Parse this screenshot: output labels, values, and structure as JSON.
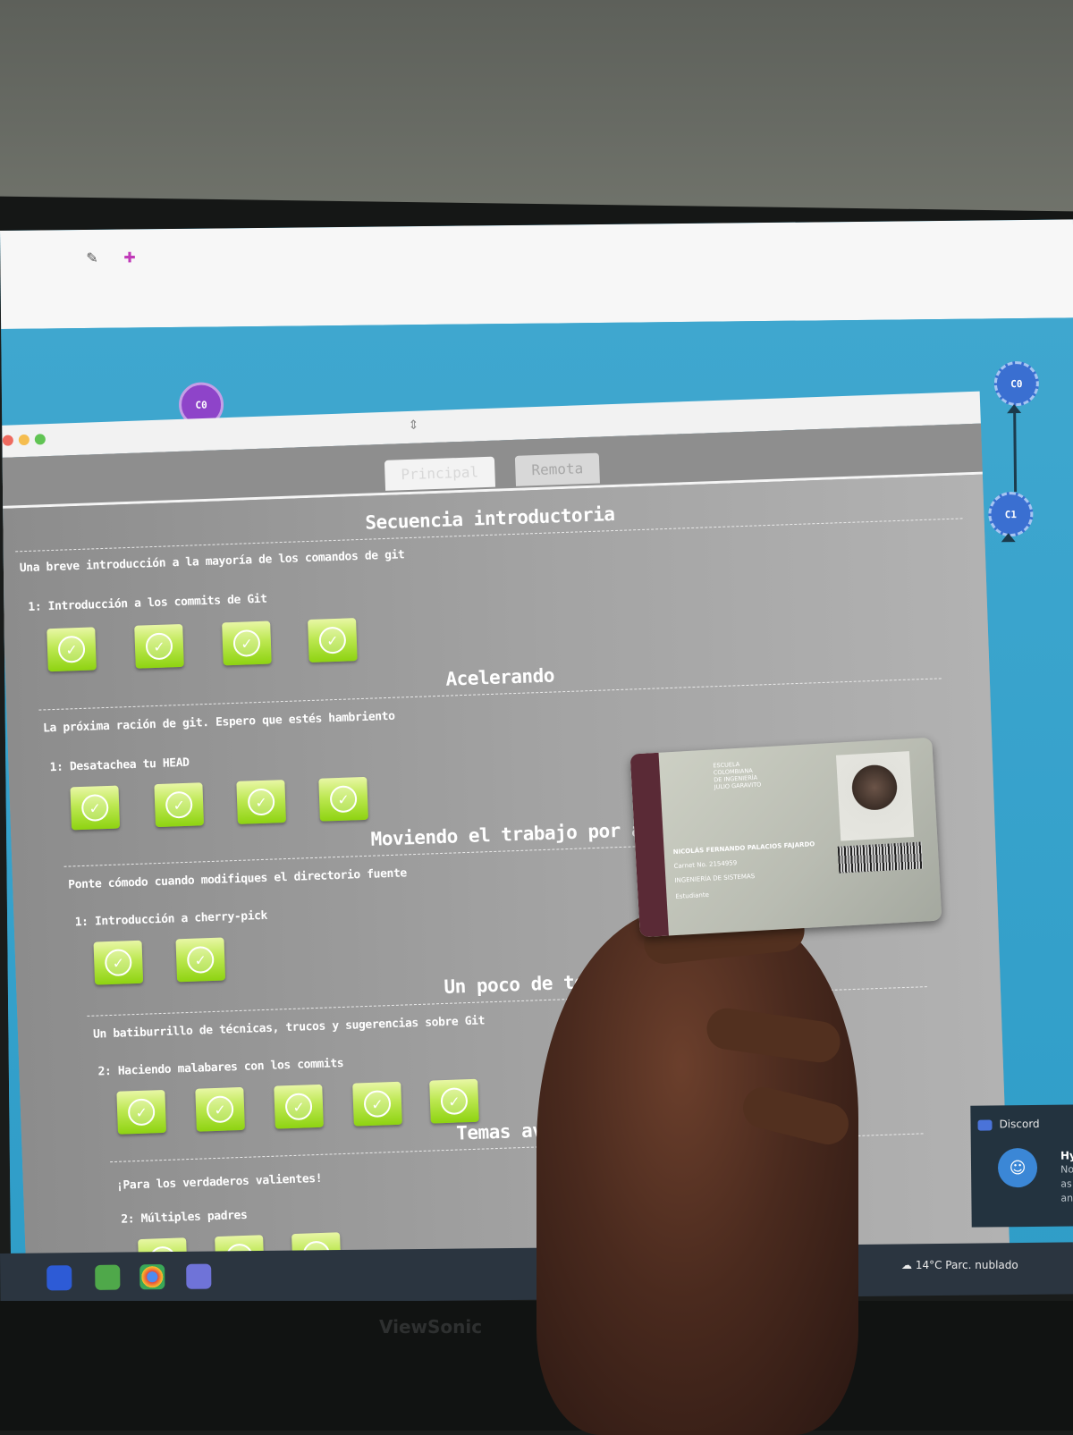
{
  "viz": {
    "node_left": "C0",
    "node_right_top": "C0",
    "node_right_mid": "C1"
  },
  "modal": {
    "tabs": [
      {
        "label": "Principal"
      },
      {
        "label": "Remota"
      }
    ],
    "sections": [
      {
        "title": "Secuencia introductoria",
        "about": "Una breve introducción a la mayoría de los comandos de git",
        "level_label": "1: Introducción a los commits de Git",
        "completed_levels": 4
      },
      {
        "title": "Acelerando",
        "about": "La próxima ración de git. Espero que estés hambriento",
        "level_label": "1: Desatachea tu HEAD",
        "completed_levels": 4
      },
      {
        "title": "Moviendo el trabajo por ahí",
        "about": "Ponte cómodo cuando modifiques el directorio fuente",
        "level_label": "1: Introducción a cherry-pick",
        "completed_levels": 2
      },
      {
        "title": "Un poco de todo",
        "about": "Un batiburrillo de técnicas, trucos y sugerencias sobre Git",
        "level_label": "2: Haciendo malabares con los commits",
        "completed_levels": 5
      },
      {
        "title": "Temas avanzados",
        "about": "¡Para los verdaderos valientes!",
        "level_label": "2: Múltiples padres",
        "completed_levels": 3
      }
    ],
    "check_glyph": "✓"
  },
  "card": {
    "school_lines": [
      "ESCUELA",
      "COLOMBIANA",
      "DE INGENIERÍA",
      "JULIO GARAVITO"
    ],
    "name": "NICOLÁS FERNANDO PALACIOS FAJARDO",
    "carnet": "Carnet No. 2154959",
    "program": "INGENIERÍA DE SISTEMAS",
    "role": "Estudiante"
  },
  "taskbar": {
    "weather": "14°C Parc. nublado"
  },
  "toast": {
    "app": "Discord",
    "title": "Hy",
    "lines": [
      "No",
      "as p",
      "and"
    ]
  },
  "monitor": {
    "brand": "ViewSonic"
  }
}
